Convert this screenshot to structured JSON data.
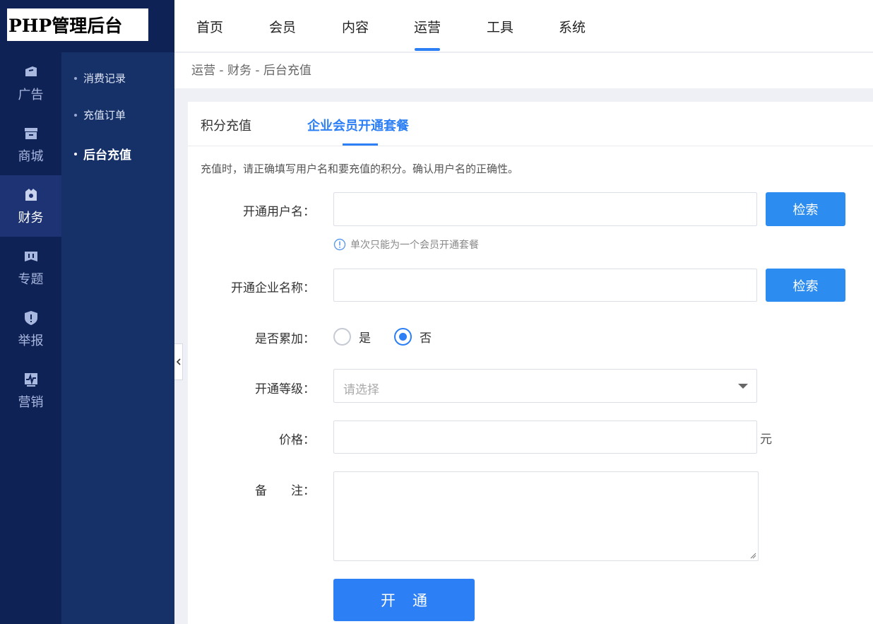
{
  "app": {
    "logo_text": "PHP管理后台"
  },
  "rail": [
    {
      "label": "广告",
      "icon": "ad-icon",
      "active": false
    },
    {
      "label": "商城",
      "icon": "store-icon",
      "active": false
    },
    {
      "label": "财务",
      "icon": "wallet-icon",
      "active": true
    },
    {
      "label": "专题",
      "icon": "topic-icon",
      "active": false
    },
    {
      "label": "举报",
      "icon": "report-shield-icon",
      "active": false
    },
    {
      "label": "营销",
      "icon": "marketing-chart-icon",
      "active": false
    }
  ],
  "subnav": [
    {
      "label": "消费记录",
      "active": false
    },
    {
      "label": "充值订单",
      "active": false
    },
    {
      "label": "后台充值",
      "active": true
    }
  ],
  "topnav": [
    {
      "label": "首页",
      "active": false
    },
    {
      "label": "会员",
      "active": false
    },
    {
      "label": "内容",
      "active": false
    },
    {
      "label": "运营",
      "active": true
    },
    {
      "label": "工具",
      "active": false
    },
    {
      "label": "系统",
      "active": false
    }
  ],
  "breadcrumb": "运营 - 财务 - 后台充值",
  "tabs": [
    {
      "label": "积分充值",
      "active": false
    },
    {
      "label": "企业会员开通套餐",
      "active": true
    }
  ],
  "notice": "充值时，请正确填写用户名和要充值的积分。确认用户名的正确性。",
  "form": {
    "username_label": "开通用户名：",
    "username_value": "",
    "search_label": "检索",
    "hint": "单次只能为一个会员开通套餐",
    "company_label": "开通企业名称：",
    "company_value": "",
    "search2_label": "检索",
    "accumulate_label": "是否累加：",
    "accumulate_options": [
      {
        "label": "是",
        "checked": false
      },
      {
        "label": "否",
        "checked": true
      }
    ],
    "level_label": "开通等级：",
    "level_placeholder": "请选择",
    "price_label": "价格：",
    "price_value": "",
    "price_unit": "元",
    "remark_label": "备　　注：",
    "remark_value": "",
    "submit_label": "开通"
  },
  "colors": {
    "primary": "#2d7ff5",
    "button": "#2d8cf0",
    "rail_bg": "#0f2255",
    "subnav_bg": "#163068"
  }
}
